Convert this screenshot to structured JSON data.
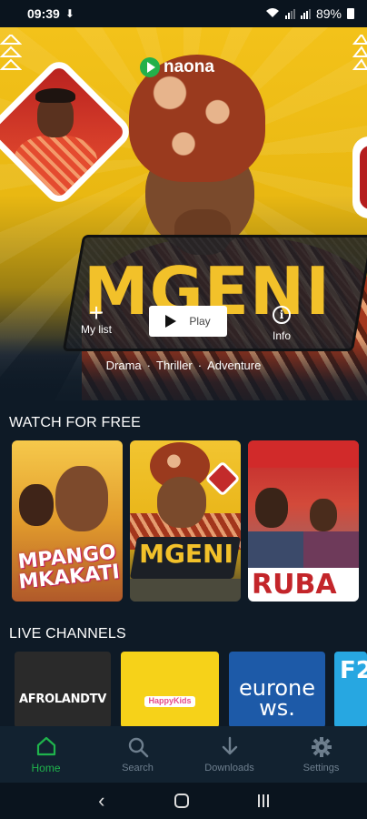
{
  "status_bar": {
    "time": "09:39",
    "battery": "89%"
  },
  "hero": {
    "brand": "naona",
    "title": "MGENI",
    "actions": {
      "my_list_label": "My list",
      "play_label": "Play",
      "info_label": "Info"
    },
    "genres": [
      "Drama",
      "Thriller",
      "Adventure"
    ],
    "accent_color": "#f2c12a"
  },
  "watch_for_free": {
    "heading": "WATCH FOR FREE",
    "items": [
      {
        "title": "MPANGO MKAKATI"
      },
      {
        "title": "MGENI"
      },
      {
        "title": "RUBA"
      }
    ]
  },
  "live_channels": {
    "heading": "LIVE CHANNELS",
    "items": [
      {
        "name": "AFROLANDTV"
      },
      {
        "name": "HappyKids"
      },
      {
        "name": "euronews."
      },
      {
        "name": "F2"
      }
    ]
  },
  "bottom_nav": {
    "items": [
      {
        "label": "Home",
        "icon": "home-icon",
        "active": true
      },
      {
        "label": "Search",
        "icon": "search-icon",
        "active": false
      },
      {
        "label": "Downloads",
        "icon": "download-icon",
        "active": false
      },
      {
        "label": "Settings",
        "icon": "gear-icon",
        "active": false
      }
    ],
    "active_color": "#1fb34c"
  }
}
